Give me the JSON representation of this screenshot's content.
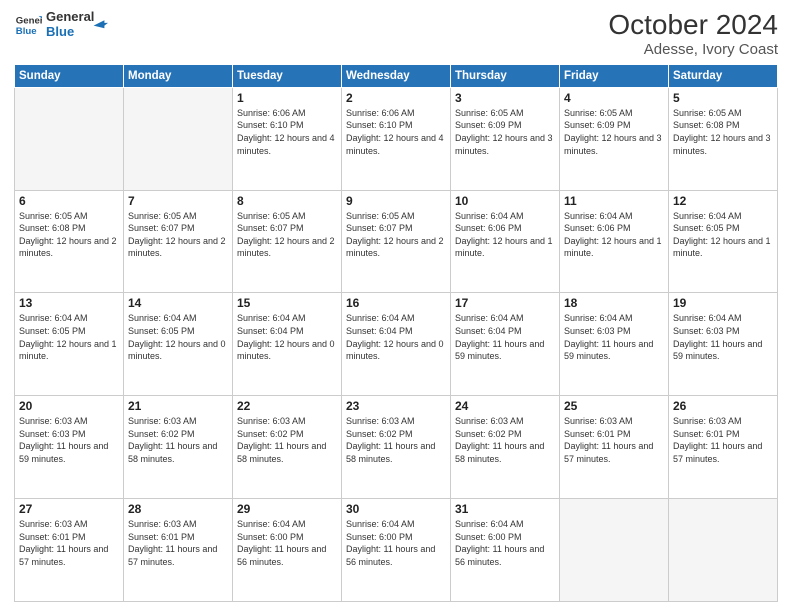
{
  "logo": {
    "line1": "General",
    "line2": "Blue"
  },
  "title": "October 2024",
  "subtitle": "Adesse, Ivory Coast",
  "weekdays": [
    "Sunday",
    "Monday",
    "Tuesday",
    "Wednesday",
    "Thursday",
    "Friday",
    "Saturday"
  ],
  "weeks": [
    [
      {
        "day": "",
        "empty": true
      },
      {
        "day": "",
        "empty": true
      },
      {
        "day": "1",
        "sunrise": "6:06 AM",
        "sunset": "6:10 PM",
        "daylight": "12 hours and 4 minutes."
      },
      {
        "day": "2",
        "sunrise": "6:06 AM",
        "sunset": "6:10 PM",
        "daylight": "12 hours and 4 minutes."
      },
      {
        "day": "3",
        "sunrise": "6:05 AM",
        "sunset": "6:09 PM",
        "daylight": "12 hours and 3 minutes."
      },
      {
        "day": "4",
        "sunrise": "6:05 AM",
        "sunset": "6:09 PM",
        "daylight": "12 hours and 3 minutes."
      },
      {
        "day": "5",
        "sunrise": "6:05 AM",
        "sunset": "6:08 PM",
        "daylight": "12 hours and 3 minutes."
      }
    ],
    [
      {
        "day": "6",
        "sunrise": "6:05 AM",
        "sunset": "6:08 PM",
        "daylight": "12 hours and 2 minutes."
      },
      {
        "day": "7",
        "sunrise": "6:05 AM",
        "sunset": "6:07 PM",
        "daylight": "12 hours and 2 minutes."
      },
      {
        "day": "8",
        "sunrise": "6:05 AM",
        "sunset": "6:07 PM",
        "daylight": "12 hours and 2 minutes."
      },
      {
        "day": "9",
        "sunrise": "6:05 AM",
        "sunset": "6:07 PM",
        "daylight": "12 hours and 2 minutes."
      },
      {
        "day": "10",
        "sunrise": "6:04 AM",
        "sunset": "6:06 PM",
        "daylight": "12 hours and 1 minute."
      },
      {
        "day": "11",
        "sunrise": "6:04 AM",
        "sunset": "6:06 PM",
        "daylight": "12 hours and 1 minute."
      },
      {
        "day": "12",
        "sunrise": "6:04 AM",
        "sunset": "6:05 PM",
        "daylight": "12 hours and 1 minute."
      }
    ],
    [
      {
        "day": "13",
        "sunrise": "6:04 AM",
        "sunset": "6:05 PM",
        "daylight": "12 hours and 1 minute."
      },
      {
        "day": "14",
        "sunrise": "6:04 AM",
        "sunset": "6:05 PM",
        "daylight": "12 hours and 0 minutes."
      },
      {
        "day": "15",
        "sunrise": "6:04 AM",
        "sunset": "6:04 PM",
        "daylight": "12 hours and 0 minutes."
      },
      {
        "day": "16",
        "sunrise": "6:04 AM",
        "sunset": "6:04 PM",
        "daylight": "12 hours and 0 minutes."
      },
      {
        "day": "17",
        "sunrise": "6:04 AM",
        "sunset": "6:04 PM",
        "daylight": "11 hours and 59 minutes."
      },
      {
        "day": "18",
        "sunrise": "6:04 AM",
        "sunset": "6:03 PM",
        "daylight": "11 hours and 59 minutes."
      },
      {
        "day": "19",
        "sunrise": "6:04 AM",
        "sunset": "6:03 PM",
        "daylight": "11 hours and 59 minutes."
      }
    ],
    [
      {
        "day": "20",
        "sunrise": "6:03 AM",
        "sunset": "6:03 PM",
        "daylight": "11 hours and 59 minutes."
      },
      {
        "day": "21",
        "sunrise": "6:03 AM",
        "sunset": "6:02 PM",
        "daylight": "11 hours and 58 minutes."
      },
      {
        "day": "22",
        "sunrise": "6:03 AM",
        "sunset": "6:02 PM",
        "daylight": "11 hours and 58 minutes."
      },
      {
        "day": "23",
        "sunrise": "6:03 AM",
        "sunset": "6:02 PM",
        "daylight": "11 hours and 58 minutes."
      },
      {
        "day": "24",
        "sunrise": "6:03 AM",
        "sunset": "6:02 PM",
        "daylight": "11 hours and 58 minutes."
      },
      {
        "day": "25",
        "sunrise": "6:03 AM",
        "sunset": "6:01 PM",
        "daylight": "11 hours and 57 minutes."
      },
      {
        "day": "26",
        "sunrise": "6:03 AM",
        "sunset": "6:01 PM",
        "daylight": "11 hours and 57 minutes."
      }
    ],
    [
      {
        "day": "27",
        "sunrise": "6:03 AM",
        "sunset": "6:01 PM",
        "daylight": "11 hours and 57 minutes."
      },
      {
        "day": "28",
        "sunrise": "6:03 AM",
        "sunset": "6:01 PM",
        "daylight": "11 hours and 57 minutes."
      },
      {
        "day": "29",
        "sunrise": "6:04 AM",
        "sunset": "6:00 PM",
        "daylight": "11 hours and 56 minutes."
      },
      {
        "day": "30",
        "sunrise": "6:04 AM",
        "sunset": "6:00 PM",
        "daylight": "11 hours and 56 minutes."
      },
      {
        "day": "31",
        "sunrise": "6:04 AM",
        "sunset": "6:00 PM",
        "daylight": "11 hours and 56 minutes."
      },
      {
        "day": "",
        "empty": true
      },
      {
        "day": "",
        "empty": true
      }
    ]
  ]
}
